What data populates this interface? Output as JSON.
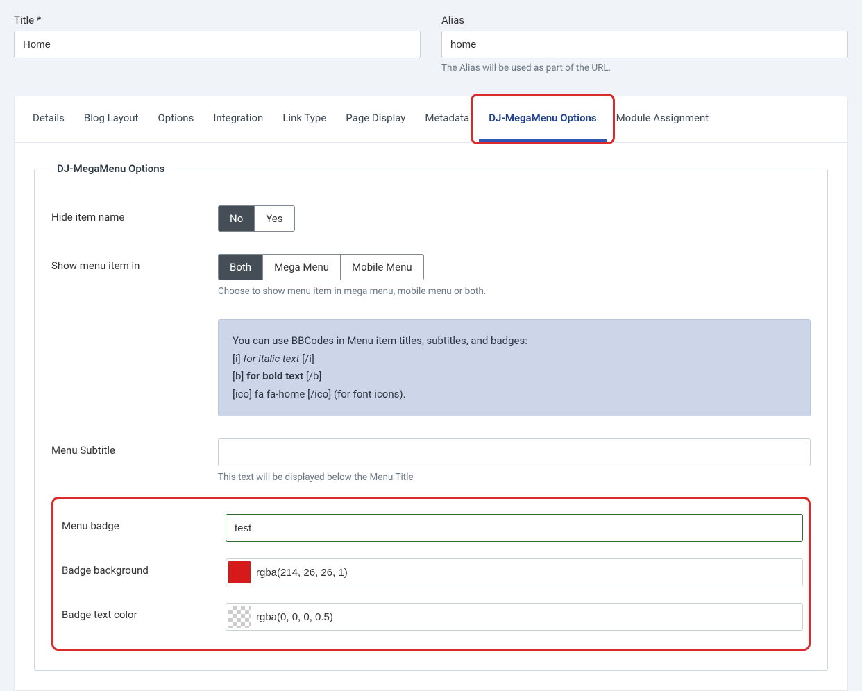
{
  "fields": {
    "title_label": "Title *",
    "title_value": "Home",
    "alias_label": "Alias",
    "alias_value": "home",
    "alias_help": "The Alias will be used as part of the URL."
  },
  "tabs": {
    "items": [
      "Details",
      "Blog Layout",
      "Options",
      "Integration",
      "Link Type",
      "Page Display",
      "Metadata",
      "DJ-MegaMenu Options",
      "Module Assignment"
    ],
    "active_index": 7
  },
  "legend": "DJ-MegaMenu Options",
  "hide_item": {
    "label": "Hide item name",
    "options": [
      "No",
      "Yes"
    ],
    "active": 0
  },
  "show_in": {
    "label": "Show menu item in",
    "options": [
      "Both",
      "Mega Menu",
      "Mobile Menu"
    ],
    "active": 0,
    "desc": "Choose to show menu item in mega menu, mobile menu or both."
  },
  "info": {
    "line1": "You can use BBCodes in Menu item titles, subtitles, and badges:",
    "i_open": "[i] ",
    "i_text": "for italic text",
    "i_close": " [/i]",
    "b_open": "[b] ",
    "b_text": "for bold text",
    "b_close": " [/b]",
    "ico_line": "[ico] fa fa-home [/ico] (for font icons)."
  },
  "subtitle": {
    "label": "Menu Subtitle",
    "value": "",
    "desc": "This text will be displayed below the Menu Title"
  },
  "badge": {
    "label": "Menu badge",
    "value": "test"
  },
  "badge_bg": {
    "label": "Badge background",
    "value": "rgba(214, 26, 26, 1)",
    "swatch": "#d61a1a"
  },
  "badge_color": {
    "label": "Badge text color",
    "value": "rgba(0, 0, 0, 0.5)"
  }
}
